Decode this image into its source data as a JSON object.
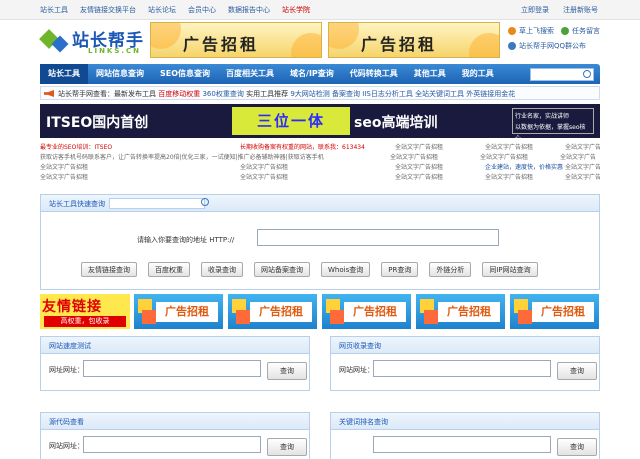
{
  "topbar": {
    "links": [
      "站长工具",
      "友情链接交换平台",
      "站长论坛",
      "会员中心",
      "数据报告中心",
      "站长学院"
    ],
    "right": [
      "立即登录",
      "注册新账号"
    ]
  },
  "logo": {
    "name": "站长帮手",
    "sub": "LINKS.CN"
  },
  "header_ads": [
    "广告招租",
    "广告招租"
  ],
  "header_links": [
    "草上飞搜索",
    "任务留言",
    "站长帮手网QQ群公布"
  ],
  "nav": {
    "items": [
      "站长工具",
      "网站信息查询",
      "SEO信息查询",
      "百度相关工具",
      "域名/IP查询",
      "代码转换工具",
      "其他工具",
      "我的工具"
    ],
    "active_index": 0
  },
  "notice": {
    "prefix": "站长帮手网查看：最新发布工具",
    "hot": "百度移动权重",
    "items": [
      "360权重查询",
      "实用工具推荐",
      "9大网站检测",
      "备案查询",
      "IIS日志分析工具",
      "全站关键词工具",
      "外英链接用金花"
    ]
  },
  "banner": {
    "left": "ITSEO国内首创",
    "highlight": "三位一体",
    "right": "seo高端培训",
    "side_line1": "行业名家，实战讲师",
    "side_line2": "以数据为依据，掌握seo核心"
  },
  "text_ads": [
    [
      "最专业的SEO培训：ITSEO",
      "长期收购备案有权重的网站，联系我：613434",
      "全站文字广告招租",
      "全站文字广告招租",
      "全站文字广告招租"
    ],
    [
      "获取访客手机号码联系客户，让广告转换率提高20倍|优化三家，一试便知|推广必备辅助神器|获取访客手机",
      "",
      "全站文字广告招租",
      "全站文字广告招租",
      "全站文字广告招租"
    ],
    [
      "全站文字广告招租",
      "全站文字广告招租",
      "全站文字广告招租",
      "企业建站，速度快，价格实惠",
      "全站文字广告招租"
    ],
    [
      "全站文字广告招租",
      "全站文字广告招租",
      "全站文字广告招租",
      "全站文字广告招租",
      "全站文字广告招租"
    ]
  ],
  "tool_panel": {
    "title": "站长工具快速查询",
    "url_label": "请输入你要查询的地址 HTTP://",
    "buttons": [
      "友情链接查询",
      "百度权重",
      "收录查询",
      "网站备案查询",
      "Whois查询",
      "PR查询",
      "外链分析",
      "同IP网站查询"
    ]
  },
  "ad_strip": {
    "friend_line1": "友情链接",
    "friend_line2": "高权重，包收录",
    "ads": [
      "广告招租",
      "广告招租",
      "广告招租",
      "广告招租",
      "广告招租",
      "广告招租"
    ]
  },
  "panels": [
    {
      "title": "网站速度测试",
      "field_label": "网址网址：",
      "button": "查询"
    },
    {
      "title": "网页收录查询",
      "field_label": "网站网址：",
      "button": "查询"
    },
    {
      "title": "源代码查看",
      "field_label": "网站网址：",
      "button": "查询"
    },
    {
      "title": "关键词排名查询",
      "field_label": "",
      "button": "查询"
    }
  ],
  "colors": {
    "nav_blue": "#1d64b4",
    "link_blue": "#2a5a9e",
    "hot_red": "#d20000",
    "ad_yellow": "#f5d46a"
  }
}
